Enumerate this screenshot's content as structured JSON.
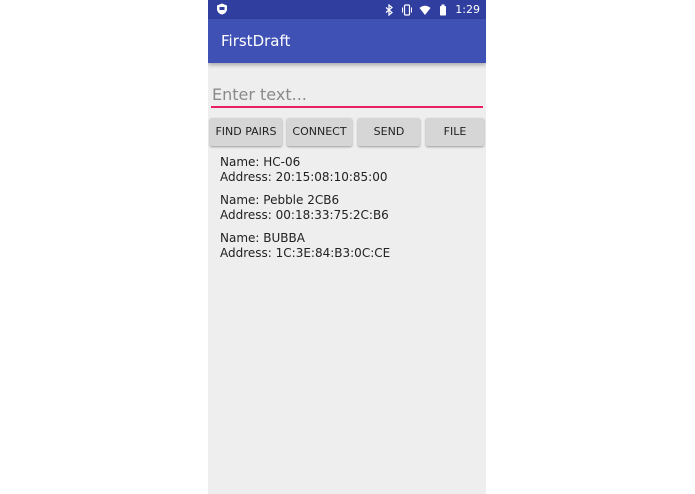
{
  "status_bar": {
    "time": "1:29",
    "icons": [
      "shield-icon",
      "bluetooth-icon",
      "vibrate-icon",
      "wifi-icon",
      "battery-icon"
    ],
    "color": "#303f9f"
  },
  "app_bar": {
    "title": "FirstDraft",
    "color": "#3f51b5"
  },
  "input": {
    "placeholder": "Enter text...",
    "value": "",
    "accent": "#e91e63"
  },
  "buttons": {
    "find_pairs": "FIND PAIRS",
    "connect": "CONNECT",
    "send": "SEND",
    "file": "FILE"
  },
  "devices": [
    {
      "name_line": "Name: HC-06",
      "address_line": "Address: 20:15:08:10:85:00"
    },
    {
      "name_line": "Name: Pebble 2CB6",
      "address_line": "Address: 00:18:33:75:2C:B6"
    },
    {
      "name_line": "Name: BUBBA",
      "address_line": "Address: 1C:3E:84:B3:0C:CE"
    }
  ]
}
